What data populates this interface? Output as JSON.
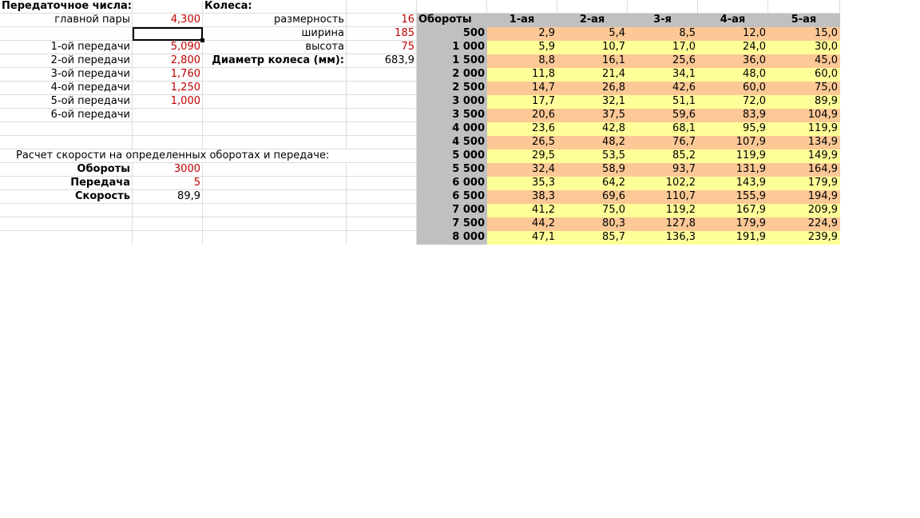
{
  "left": {
    "title": "Передаточное числа:",
    "main_pair_label": "главной пары",
    "main_pair_value": "4,300",
    "gears": [
      {
        "label": "1-ой передачи",
        "value": "5,090"
      },
      {
        "label": "2-ой передачи",
        "value": "2,800"
      },
      {
        "label": "3-ой передачи",
        "value": "1,760"
      },
      {
        "label": "4-ой передачи",
        "value": "1,250"
      },
      {
        "label": "5-ой передачи",
        "value": "1,000"
      },
      {
        "label": "6-ой передачи",
        "value": ""
      }
    ],
    "calc_title": "Расчет скорости на определенных оборотах и передаче:",
    "rpm_label": "Обороты",
    "rpm_value": "3000",
    "gear_label": "Передача",
    "gear_value": "5",
    "speed_label": "Скорость",
    "speed_value": "89,9"
  },
  "wheels": {
    "title": "Колеса:",
    "size_label": "размерность",
    "size_value": "16",
    "width_label": "ширина",
    "width_value": "185",
    "height_label": "высота",
    "height_value": "75",
    "diameter_label": "Диаметр колеса (мм):",
    "diameter_value": "683,9"
  },
  "speed_table": {
    "header": [
      "Обороты",
      "1-ая",
      "2-ая",
      "3-я",
      "4-ая",
      "5-ая"
    ],
    "rows": [
      {
        "rpm": "500",
        "v": [
          "2,9",
          "5,4",
          "8,5",
          "12,0",
          "15,0"
        ]
      },
      {
        "rpm": "1 000",
        "v": [
          "5,9",
          "10,7",
          "17,0",
          "24,0",
          "30,0"
        ]
      },
      {
        "rpm": "1 500",
        "v": [
          "8,8",
          "16,1",
          "25,6",
          "36,0",
          "45,0"
        ]
      },
      {
        "rpm": "2 000",
        "v": [
          "11,8",
          "21,4",
          "34,1",
          "48,0",
          "60,0"
        ]
      },
      {
        "rpm": "2 500",
        "v": [
          "14,7",
          "26,8",
          "42,6",
          "60,0",
          "75,0"
        ]
      },
      {
        "rpm": "3 000",
        "v": [
          "17,7",
          "32,1",
          "51,1",
          "72,0",
          "89,9"
        ]
      },
      {
        "rpm": "3 500",
        "v": [
          "20,6",
          "37,5",
          "59,6",
          "83,9",
          "104,9"
        ]
      },
      {
        "rpm": "4 000",
        "v": [
          "23,6",
          "42,8",
          "68,1",
          "95,9",
          "119,9"
        ]
      },
      {
        "rpm": "4 500",
        "v": [
          "26,5",
          "48,2",
          "76,7",
          "107,9",
          "134,9"
        ]
      },
      {
        "rpm": "5 000",
        "v": [
          "29,5",
          "53,5",
          "85,2",
          "119,9",
          "149,9"
        ]
      },
      {
        "rpm": "5 500",
        "v": [
          "32,4",
          "58,9",
          "93,7",
          "131,9",
          "164,9"
        ]
      },
      {
        "rpm": "6 000",
        "v": [
          "35,3",
          "64,2",
          "102,2",
          "143,9",
          "179,9"
        ]
      },
      {
        "rpm": "6 500",
        "v": [
          "38,3",
          "69,6",
          "110,7",
          "155,9",
          "194,9"
        ]
      },
      {
        "rpm": "7 000",
        "v": [
          "41,2",
          "75,0",
          "119,2",
          "167,9",
          "209,9"
        ]
      },
      {
        "rpm": "7 500",
        "v": [
          "44,2",
          "80,3",
          "127,8",
          "179,9",
          "224,9"
        ]
      },
      {
        "rpm": "8 000",
        "v": [
          "47,1",
          "85,7",
          "136,3",
          "191,9",
          "239,9"
        ]
      }
    ]
  },
  "colors": {
    "header_gray": "#c0c0c0",
    "band_orange": "#fcc896",
    "band_yellow": "#ffff99",
    "value_red": "#c00000"
  }
}
